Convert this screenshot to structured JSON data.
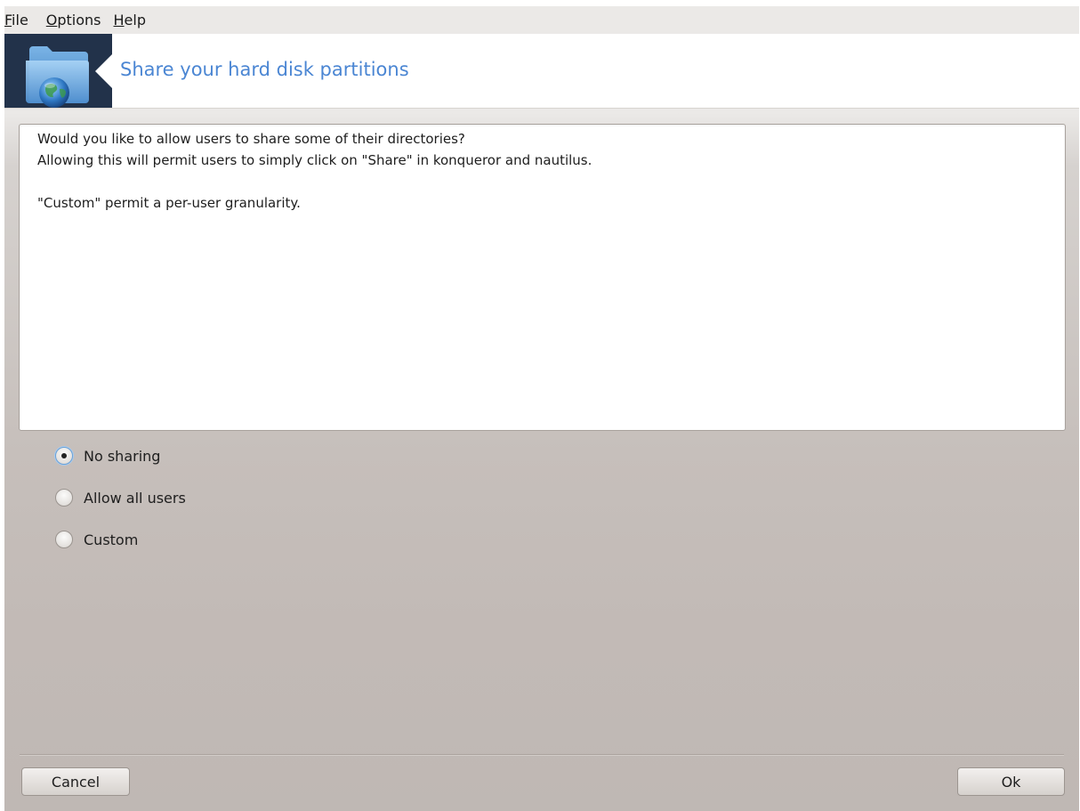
{
  "menubar": {
    "items": [
      {
        "mnemonic": "F",
        "rest": "ile"
      },
      {
        "mnemonic": "O",
        "rest": "ptions"
      },
      {
        "mnemonic": "H",
        "rest": "elp"
      }
    ]
  },
  "header": {
    "icon": "folder-globe-icon",
    "title": "Share your hard disk partitions"
  },
  "description": {
    "line1": "Would you like to allow users to share some of their directories?",
    "line2": "Allowing this will permit users to simply click on \"Share\" in konqueror and nautilus.",
    "line3": "",
    "line4": "\"Custom\" permit a per-user granularity."
  },
  "options": {
    "selected": "No sharing",
    "items": [
      "No sharing",
      "Allow all users",
      "Custom"
    ]
  },
  "buttons": {
    "cancel": "Cancel",
    "ok": "Ok"
  },
  "colors": {
    "title": "#4b86d3",
    "icon_box": "#22324a"
  }
}
